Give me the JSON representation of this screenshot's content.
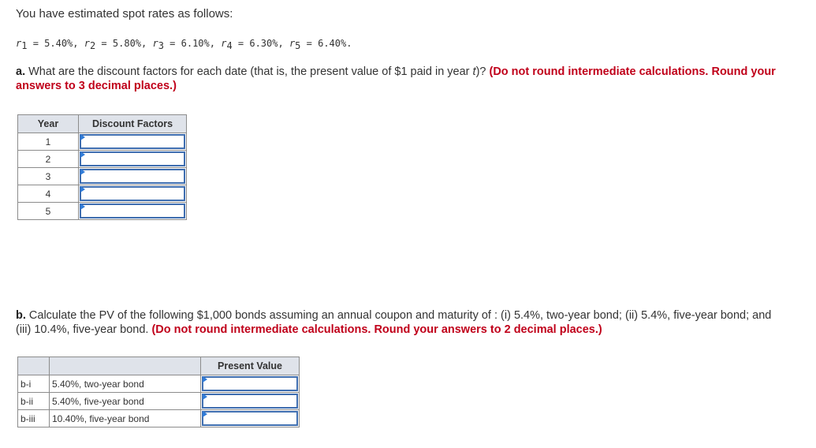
{
  "intro": "You have estimated spot rates as follows:",
  "spot_rates": [
    {
      "label": "r",
      "sub": "1",
      "value": "5.40%"
    },
    {
      "label": "r",
      "sub": "2",
      "value": "5.80%"
    },
    {
      "label": "r",
      "sub": "3",
      "value": "6.10%"
    },
    {
      "label": "r",
      "sub": "4",
      "value": "6.30%"
    },
    {
      "label": "r",
      "sub": "5",
      "value": "6.40%"
    }
  ],
  "part_a": {
    "label": "a.",
    "question": "What are the discount factors for each date (that is, the present value of $1 paid in year ",
    "question_var": "t",
    "question_end": ")?",
    "instruction": "(Do not round intermediate calculations. Round your answers to 3 decimal places.)",
    "table": {
      "headers": [
        "Year",
        "Discount Factors"
      ],
      "rows": [
        {
          "year": "1",
          "value": ""
        },
        {
          "year": "2",
          "value": ""
        },
        {
          "year": "3",
          "value": ""
        },
        {
          "year": "4",
          "value": ""
        },
        {
          "year": "5",
          "value": ""
        }
      ]
    }
  },
  "part_b": {
    "label": "b.",
    "question": "Calculate the PV of the following $1,000 bonds assuming an annual coupon and maturity of : (i) 5.4%, two-year bond; (ii) 5.4%, five-year bond; and (iii) 10.4%, five-year bond.",
    "instruction": "(Do not round intermediate calculations. Round your answers to 2 decimal places.)",
    "table": {
      "headers": [
        "",
        "",
        "Present Value"
      ],
      "rows": [
        {
          "id": "b-i",
          "desc": "5.40%, two-year bond",
          "value": ""
        },
        {
          "id": "b-ii",
          "desc": "5.40%, five-year bond",
          "value": ""
        },
        {
          "id": "b-iii",
          "desc": "10.40%, five-year bond",
          "value": ""
        }
      ]
    }
  },
  "colors": {
    "instruction_red": "#c0001a",
    "header_bg": "#dfe3ea",
    "input_border": "#3f6eb0",
    "input_flag": "#2f7bd8"
  }
}
